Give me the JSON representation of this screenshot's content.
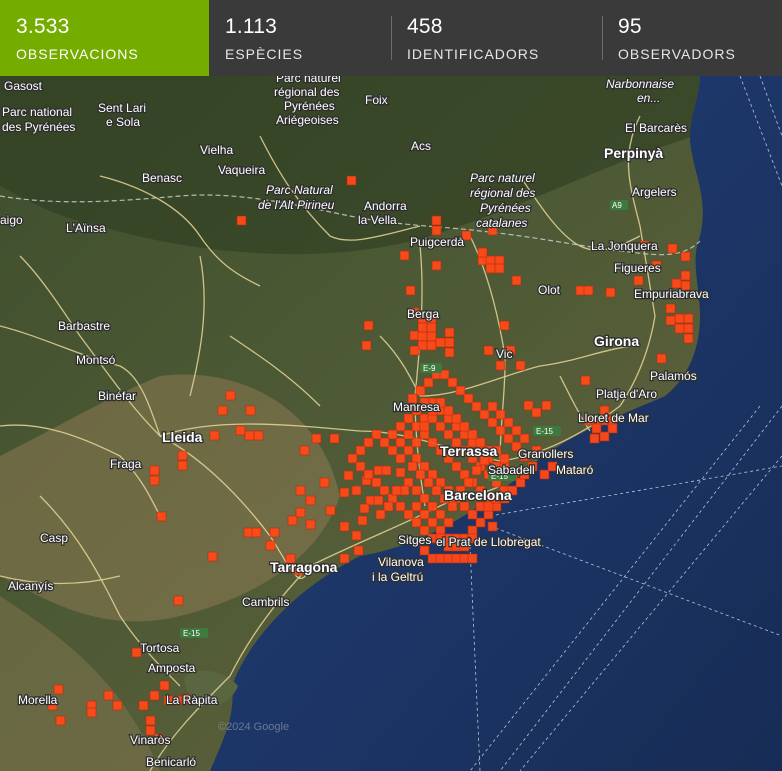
{
  "stats": {
    "observations": {
      "value": "3.533",
      "label": "OBSERVACIONS"
    },
    "species": {
      "value": "1.113",
      "label": "ESPÈCIES"
    },
    "identifiers": {
      "value": "458",
      "label": "IDENTIFICADORS"
    },
    "observers": {
      "value": "95",
      "label": "OBSERVADORS"
    }
  },
  "colors": {
    "active_tab": "#74ac00",
    "bar": "#3a3a3a",
    "cell": "#ff4a1a",
    "sea": "#1d3764"
  },
  "map": {
    "labels": {
      "gasost": "Gasost",
      "pn_pyr1": "Parc national",
      "pn_pyr2": "des Pyrénées",
      "sentlari1": "Sent Lari",
      "sentlari2": "e Sola",
      "pnr_ari1": "Parc naturel",
      "pnr_ari2": "régional des",
      "pnr_ari3": "Pyrénées",
      "pnr_ari4": "Ariégeoises",
      "foix": "Foix",
      "narbonnaise1": "Narbonnaise",
      "narbonnaise2": "en...",
      "elbarcares": "El Barcarès",
      "perpinya": "Perpinyà",
      "argelers": "Argelers",
      "vielha": "Vielha",
      "acs": "Acs",
      "benasc": "Benasc",
      "vaqueira": "Vaqueira",
      "pnap1": "Parc Natural",
      "pnap2": "de l'Alt Pirineu",
      "pnr_cat1": "Parc naturel",
      "pnr_cat2": "régional des",
      "pnr_cat3": "Pyrénées",
      "pnr_cat4": "catalanes",
      "andorra1": "Andorra",
      "andorra2": "la Vella",
      "aigo": "aigo",
      "ainsa": "L'Aïnsa",
      "puigcerda": "Puigcerdà",
      "jonquera": "La Jonquera",
      "figueres": "Figueres",
      "empuriabrava": "Empuriabrava",
      "olot": "Olot",
      "barbastre": "Barbastre",
      "berga": "Berga",
      "girona": "Girona",
      "montso": "Montsó",
      "vic": "Vic",
      "palamos": "Palamós",
      "binefar": "Binéfar",
      "platja": "Platja d'Aro",
      "manresa": "Manresa",
      "lloret": "Lloret de Mar",
      "lleida": "Lleida",
      "fraga": "Fraga",
      "terrassa": "Terrassa",
      "granollers": "Granollers",
      "sabadell": "Sabadell",
      "mataro": "Mataró",
      "barcelona": "Barcelona",
      "casp": "Casp",
      "sitges": "Sitges",
      "prat": "el Prat de Llobregat",
      "tarragona": "Tarragona",
      "vilanova1": "Vilanova",
      "vilanova2": "i la Geltrú",
      "alcanyis": "Alcanyís",
      "cambrils": "Cambrils",
      "tortosa": "Tortosa",
      "amposta": "Amposta",
      "rapita": "La Ràpita",
      "morella": "Morella",
      "vinaros": "Vinaròs",
      "benicarlo": "Benicarló",
      "copyright": "©2024 Google"
    },
    "shields": {
      "a9": "A9",
      "e15a": "E-15",
      "e15b": "E-15",
      "e15c": "E-15",
      "e9": "E-9"
    }
  }
}
